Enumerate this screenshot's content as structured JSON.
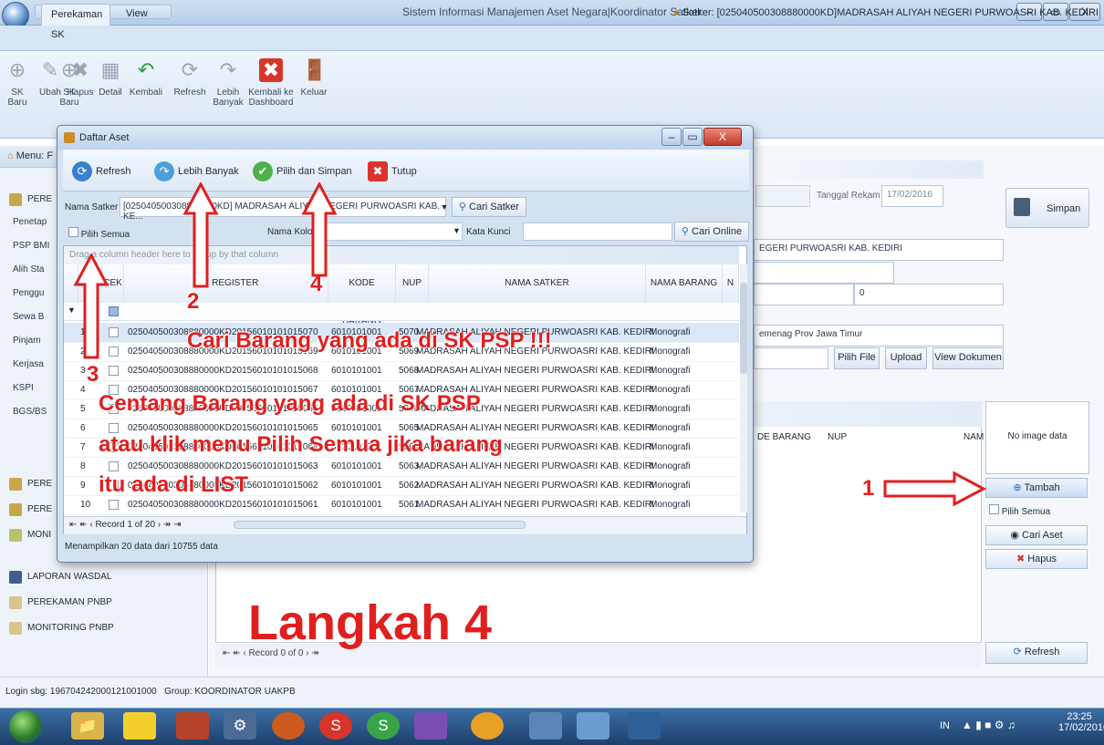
{
  "window": {
    "title": "Sistem Informasi Manajemen Aset Negara|Koordinator Satker",
    "min": "–",
    "max": "▭",
    "close": "X"
  },
  "ribbon": {
    "tabs": [
      "Perekaman SK",
      "View"
    ],
    "satker": "Satker: [025040500308880000KD]MADRASAH ALIYAH NEGERI PURWOASRI KAB. KEDIRI",
    "buttons": [
      {
        "label": "SK Baru",
        "icon": "plus-icon"
      },
      {
        "label": "Ubah",
        "icon": "pencil-icon"
      },
      {
        "label": "Hapus",
        "icon": "x-icon"
      },
      {
        "label": "Detail",
        "icon": "grid-icon"
      },
      {
        "label": "Kembali",
        "icon": "undo-icon"
      },
      {
        "label": "Refresh",
        "icon": "refresh-icon"
      },
      {
        "label": "Lebih Banyak",
        "icon": "more-icon"
      },
      {
        "label": "Kembali ke Dashboard",
        "icon": "dashboard-icon"
      },
      {
        "label": "Keluar",
        "icon": "exit-icon"
      }
    ]
  },
  "nav": {
    "header": "Menu: F",
    "items": [
      "Penetap",
      "PSP BMI",
      "Alih Sta",
      "Penggu",
      "Sewa B",
      "Pinjam",
      "Kerjasa",
      "KSPI",
      "BGS/BS"
    ],
    "groups": [
      "PERE",
      "PERE",
      "PERE",
      "MONI",
      "LAPORAN WASDAL",
      "PEREKAMAN PNBP",
      "MONITORING PNBP"
    ]
  },
  "main": {
    "tanggal_label": "Tanggal Rekam",
    "tanggal_value": "17/02/2016",
    "simpan": "Simpan",
    "satker_field": "EGERI PURWOASRI KAB. KEDIRI",
    "num_field": "0",
    "kemenag_field": "emenag Prov Jawa Timur",
    "pilih_file": "Pilih File",
    "upload": "Upload",
    "view_dokumen": "View Dokumen",
    "grid_cols": [
      "DE BARANG",
      "NUP",
      "NAM"
    ],
    "no_image": "No image data",
    "tambah": "Tambah",
    "pilih_semua": "Pilih Semua",
    "cari_aset": "Cari Aset",
    "hapus": "Hapus",
    "refresh": "Refresh",
    "pager": "Record 0 of 0"
  },
  "dialog": {
    "title": "Daftar Aset",
    "toolbar": {
      "refresh": "Refresh",
      "lebih": "Lebih Banyak",
      "pilih": "Pilih dan Simpan",
      "tutup": "Tutup"
    },
    "nama_satker_label": "Nama Satker",
    "nama_satker_value": "[025040500308880000KD] MADRASAH ALIYAH NEGERI PURWOASRI KAB. KE...",
    "cari_satker": "Cari Satker",
    "pilih_semua": "Pilih Semua",
    "nama_kolom": "Nama Kolom",
    "kata_kunci": "Kata Kunci",
    "cari_online": "Cari Online",
    "group_hint": "Drag a column header here to group by that column",
    "columns": [
      "NO",
      "CEK",
      "NO. REGISTER",
      "KODE BARANG",
      "NUP",
      "NAMA SATKER",
      "NAMA BARANG",
      "N"
    ],
    "rows": [
      {
        "no": "1",
        "reg": "025040500308880000KD20156010101015070",
        "kode": "6010101001",
        "nup": "5070",
        "satker": "MADRASAH ALIYAH NEGERI PURWOASRI KAB. KEDIRI",
        "barang": "Monografi"
      },
      {
        "no": "2",
        "reg": "025040500308880000KD20156010101015069",
        "kode": "6010101001",
        "nup": "5069",
        "satker": "MADRASAH ALIYAH NEGERI PURWOASRI KAB. KEDIRI",
        "barang": "Monografi"
      },
      {
        "no": "3",
        "reg": "025040500308880000KD20156010101015068",
        "kode": "6010101001",
        "nup": "5068",
        "satker": "MADRASAH ALIYAH NEGERI PURWOASRI KAB. KEDIRI",
        "barang": "Monografi"
      },
      {
        "no": "4",
        "reg": "025040500308880000KD20156010101015067",
        "kode": "6010101001",
        "nup": "5067",
        "satker": "MADRASAH ALIYAH NEGERI PURWOASRI KAB. KEDIRI",
        "barang": "Monografi"
      },
      {
        "no": "5",
        "reg": "025040500308880000KD20156010101015066",
        "kode": "6010101001",
        "nup": "5066",
        "satker": "MADRASAH ALIYAH NEGERI PURWOASRI KAB. KEDIRI",
        "barang": "Monografi"
      },
      {
        "no": "6",
        "reg": "025040500308880000KD20156010101015065",
        "kode": "6010101001",
        "nup": "5065",
        "satker": "MADRASAH ALIYAH NEGERI PURWOASRI KAB. KEDIRI",
        "barang": "Monografi"
      },
      {
        "no": "7",
        "reg": "025040500308880000KD20156010101015064",
        "kode": "6010101001",
        "nup": "5064",
        "satker": "MADRASAH ALIYAH NEGERI PURWOASRI KAB. KEDIRI",
        "barang": "Monografi"
      },
      {
        "no": "8",
        "reg": "025040500308880000KD20156010101015063",
        "kode": "6010101001",
        "nup": "5063",
        "satker": "MADRASAH ALIYAH NEGERI PURWOASRI KAB. KEDIRI",
        "barang": "Monografi"
      },
      {
        "no": "9",
        "reg": "025040500308880000KD20156010101015062",
        "kode": "6010101001",
        "nup": "5062",
        "satker": "MADRASAH ALIYAH NEGERI PURWOASRI KAB. KEDIRI",
        "barang": "Monografi"
      },
      {
        "no": "10",
        "reg": "025040500308880000KD20156010101015061",
        "kode": "6010101001",
        "nup": "5061",
        "satker": "MADRASAH ALIYAH NEGERI PURWOASRI KAB. KEDIRI",
        "barang": "Monografi"
      }
    ],
    "pager": "Record 1 of 20",
    "status": "Menampilkan 20 data dari 10755 data"
  },
  "annotations": {
    "n1": "1",
    "n2": "2",
    "n3": "3",
    "n4": "4",
    "line1": "Cari Barang yang ada di SK PSP !!!",
    "line2": "Centang Barang yang ada di SK PSP",
    "line3": "atau klik menu Pilih Semua jika barang",
    "line4": "itu ada di LIST",
    "big": "Langkah 4",
    "color": "#e01f1f"
  },
  "status": {
    "login": "Login sbg: 196704242000121001000",
    "group": "Group: KOORDINATOR UAKPB"
  },
  "taskbar": {
    "lang": "IN",
    "time": "23:25",
    "date": "17/02/2016"
  }
}
